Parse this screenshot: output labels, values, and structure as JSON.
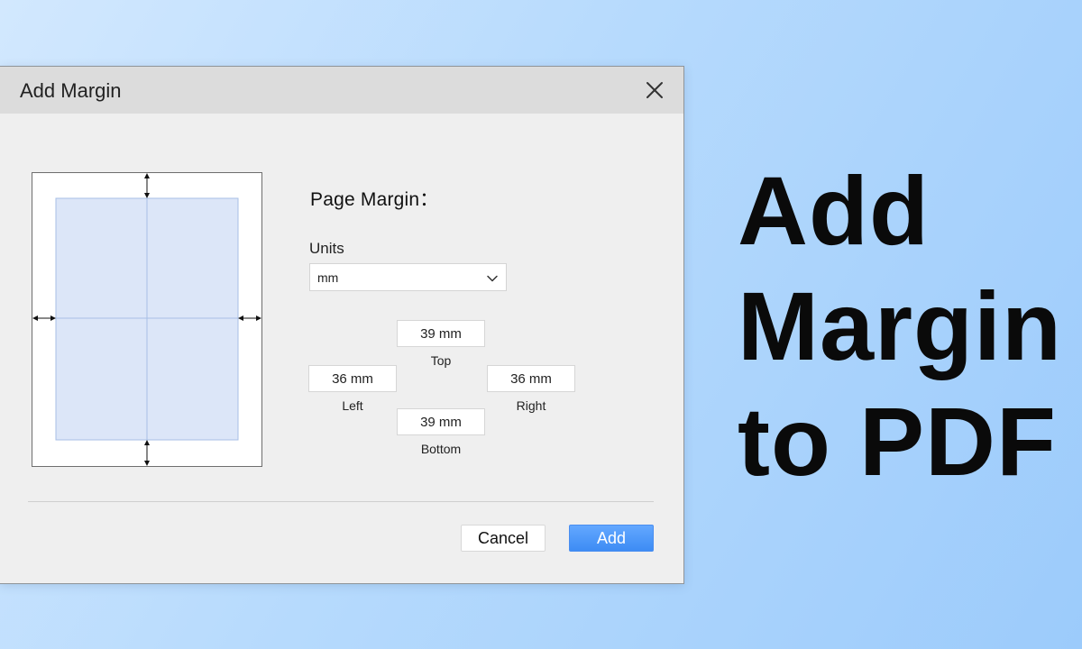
{
  "dialog": {
    "title": "Add Margin",
    "close_icon": "close-icon"
  },
  "panel": {
    "section_title": "Page Margin：",
    "units_label": "Units",
    "units_value": "mm",
    "units_icon": "chevron-down-icon"
  },
  "margins": {
    "top": {
      "value": "39 mm",
      "label": "Top"
    },
    "left": {
      "value": "36 mm",
      "label": "Left"
    },
    "right": {
      "value": "36 mm",
      "label": "Right"
    },
    "bottom": {
      "value": "39 mm",
      "label": "Bottom"
    }
  },
  "buttons": {
    "cancel": "Cancel",
    "add": "Add"
  },
  "hero": {
    "line1": "Add",
    "line2": "Margin",
    "line3": "to PDF"
  },
  "colors": {
    "accent": "#4a8ef0",
    "content_fill": "#dce6f8",
    "content_stroke": "#a7bfe6"
  }
}
